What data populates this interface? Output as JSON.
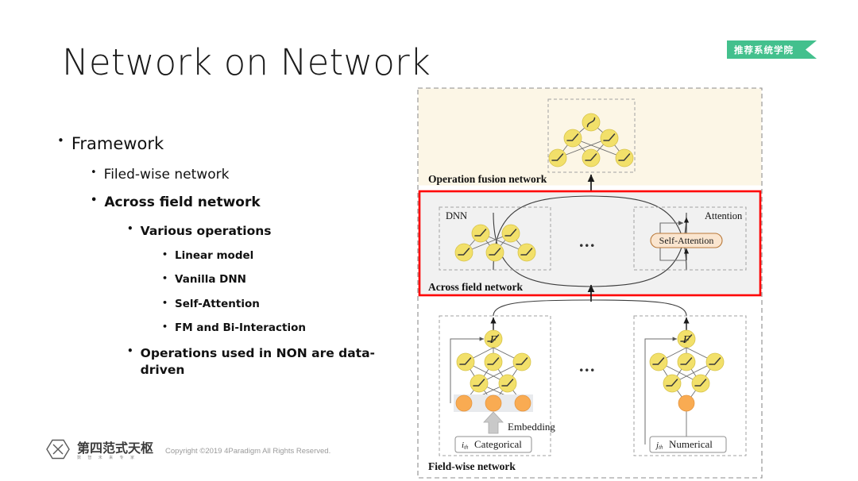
{
  "slide": {
    "title": "Network on Network",
    "badge": "推荐系统学院"
  },
  "bullets": [
    {
      "level": 1,
      "text": "Framework",
      "bold": false
    },
    {
      "level": 2,
      "text": "Filed-wise network",
      "bold": false
    },
    {
      "level": 2,
      "text": "Across field network",
      "bold": true
    },
    {
      "level": 3,
      "text": "Various operations",
      "bold": true
    },
    {
      "level": 4,
      "text": "Linear model",
      "bold": true
    },
    {
      "level": 4,
      "text": "Vanilla DNN",
      "bold": true
    },
    {
      "level": 4,
      "text": "Self-Attention",
      "bold": true
    },
    {
      "level": 4,
      "text": "FM and Bi-Interaction",
      "bold": true
    },
    {
      "level": 3,
      "text": "Operations used in NON are data-driven",
      "bold": true
    }
  ],
  "bullet_glyph": "•",
  "footer": {
    "brand_cn": "第四范式天枢",
    "brand_sub": "数 智 未 来 专 家",
    "copyright": "Copyright ©2019 4Paradigm All Rights Reserved.",
    "logo_icon": "hexagon-x-logo-icon"
  },
  "diagram": {
    "sections": {
      "operation_fusion": "Operation fusion network",
      "across_field": "Across field network",
      "field_wise": "Field-wise network"
    },
    "across_field": {
      "left_box_label": "DNN",
      "right_box_label": "Attention",
      "attention_op": "Self-Attention",
      "ellipsis": "..."
    },
    "field_wise": {
      "fusion_node": "F",
      "embedding_label": "Embedding",
      "left_input": "Categorical",
      "left_input_sub": "i",
      "left_input_sub2": "th",
      "right_input": "Numerical",
      "right_input_sub": "j",
      "right_input_sub2": "th",
      "ellipsis": "..."
    },
    "colors": {
      "fusion_band": "#fcf6e6",
      "across_band": "#f1f1f1",
      "highlight_border": "#ff0000",
      "relu_node": "#f2e06a",
      "embed_node": "#f9ab52",
      "attention_pill_fill": "#fae5cf",
      "attention_pill_border": "#b9793a",
      "dash_border": "#999999"
    }
  }
}
